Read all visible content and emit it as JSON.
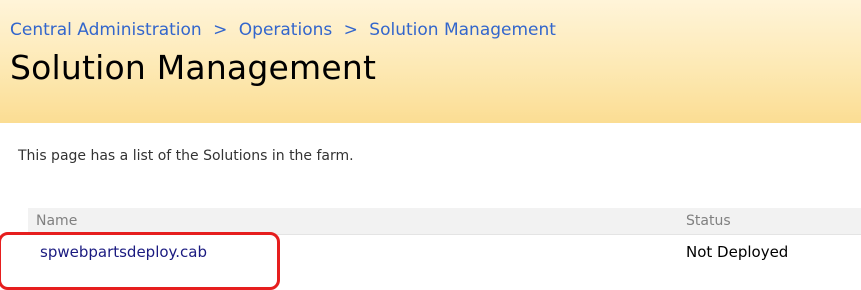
{
  "breadcrumb": {
    "items": [
      {
        "label": "Central Administration"
      },
      {
        "label": "Operations"
      },
      {
        "label": "Solution Management"
      }
    ],
    "separator": ">"
  },
  "page": {
    "title": "Solution Management",
    "description": "This page has a list of the Solutions in the farm."
  },
  "solutions_list": {
    "columns": {
      "name": "Name",
      "status": "Status"
    },
    "rows": [
      {
        "name": "spwebpartsdeploy.cab",
        "status": "Not Deployed"
      }
    ]
  },
  "colors": {
    "title_area_bg": "#fde9b4",
    "breadcrumb_link": "#3366cc",
    "row_link": "#1a1a80",
    "highlight": "#e61e1e"
  }
}
